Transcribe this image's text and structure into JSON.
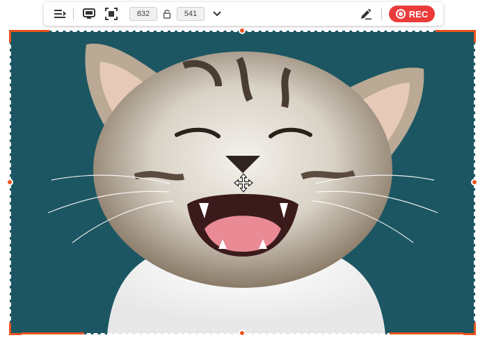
{
  "toolbar": {
    "width_value": "832",
    "height_value": "541",
    "rec_label": "REC",
    "icons": [
      "toggle-panel-icon",
      "monitor-icon",
      "fullscreen-region-icon",
      "aspect-lock-icon",
      "chevron-down-icon",
      "pen-edit-icon",
      "record-icon"
    ]
  },
  "capture": {
    "subject": "kitten photo",
    "background_color": "#1c5662"
  },
  "colors": {
    "accent": "#e8541e",
    "record": "#ec3b3b"
  }
}
